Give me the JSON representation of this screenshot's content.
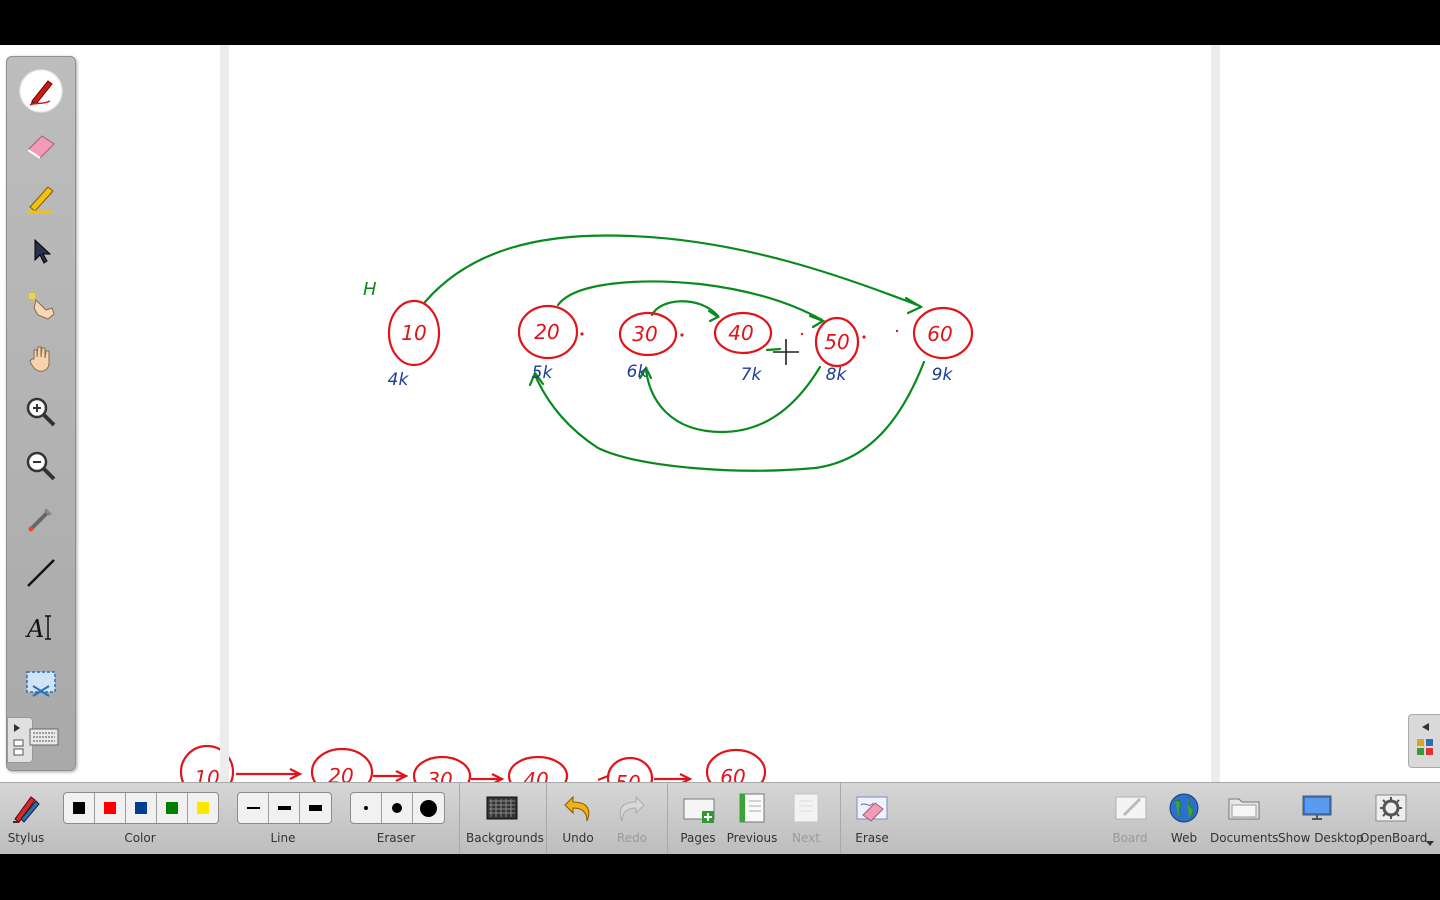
{
  "toolbar": {
    "stylus_label": "Stylus",
    "color_label": "Color",
    "line_label": "Line",
    "eraser_label": "Eraser",
    "backgrounds_label": "Backgrounds",
    "undo_label": "Undo",
    "redo_label": "Redo",
    "pages_label": "Pages",
    "previous_label": "Previous",
    "next_label": "Next",
    "erase_label": "Erase",
    "board_label": "Board",
    "web_label": "Web",
    "documents_label": "Documents",
    "show_desktop_label": "Show Desktop",
    "openboard_label": "OpenBoard",
    "colors": [
      "#000000",
      "#ff0000",
      "#003f8f",
      "#008000",
      "#ffe600"
    ],
    "line_widths": [
      "thin",
      "medium",
      "thick"
    ],
    "eraser_sizes": [
      "small",
      "medium",
      "large"
    ]
  },
  "palette": {
    "tools": [
      "pen-icon",
      "eraser-icon",
      "marker-icon",
      "selector-icon",
      "interact-icon",
      "hand-icon",
      "zoom-in-icon",
      "zoom-out-icon",
      "laser-pointer-icon",
      "line-icon",
      "text-icon",
      "capture-icon"
    ],
    "active_tool": "pen-icon"
  },
  "whiteboard": {
    "nodes": [
      {
        "label": "10",
        "weight": "4k"
      },
      {
        "label": "20",
        "weight": "5k"
      },
      {
        "label": "30",
        "weight": "6k"
      },
      {
        "label": "40",
        "weight": "7k"
      },
      {
        "label": "50",
        "weight": "8k"
      },
      {
        "label": "60",
        "weight": "9k"
      }
    ],
    "head_label": "H",
    "bottom_nodes": [
      "10",
      "20",
      "30",
      "40",
      "50",
      "60"
    ],
    "ink_colors": {
      "nodes": "#e0141b",
      "links": "#0a8a1e",
      "weights": "#1d3f93"
    }
  }
}
